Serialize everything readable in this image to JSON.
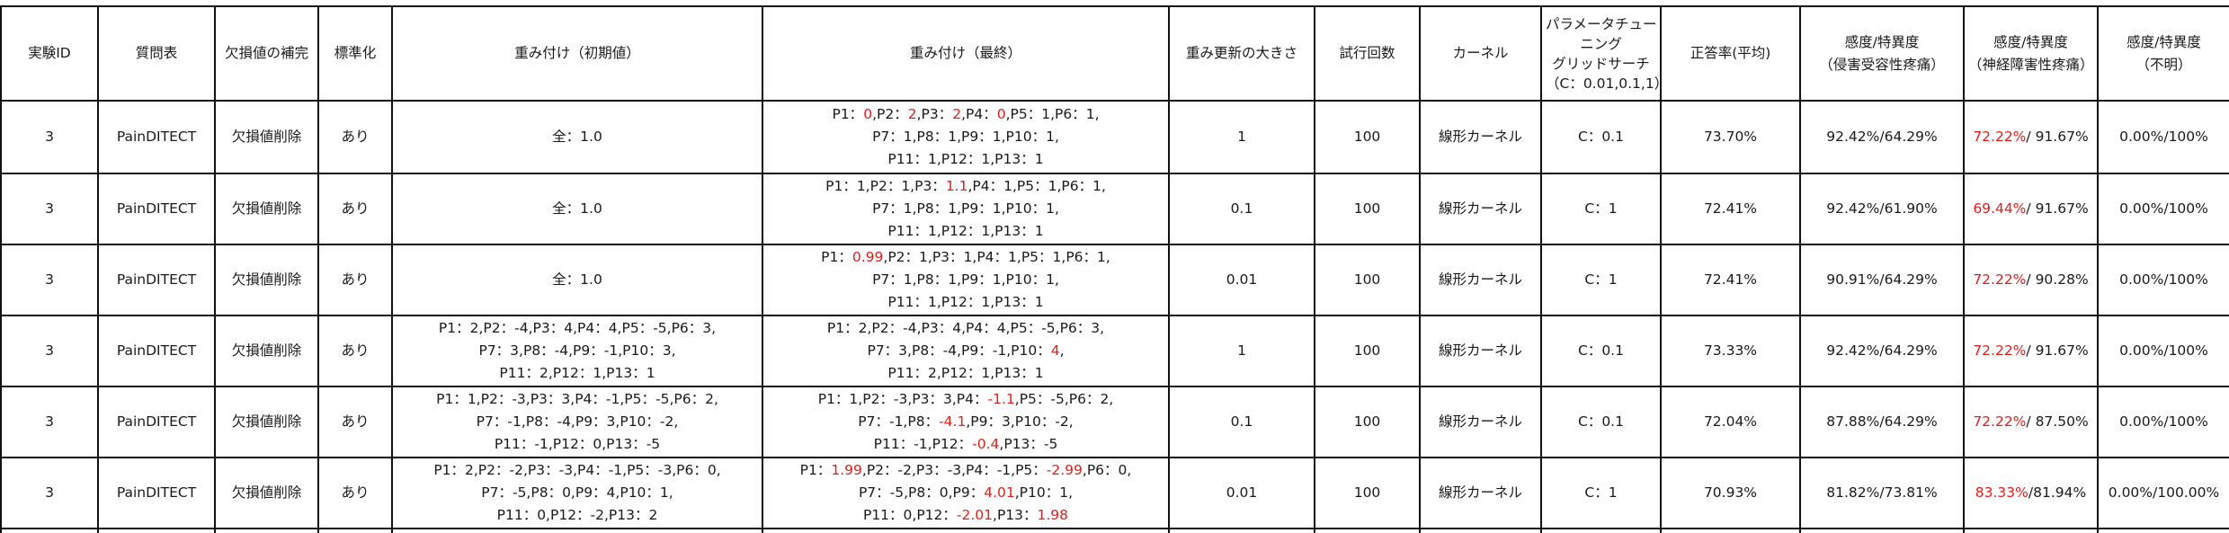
{
  "headers": [
    "実験ID",
    "質問表",
    "欠損値の補完",
    "標準化",
    "重み付け（初期値）",
    "重み付け（最終）",
    "重み更新の大きさ",
    "試行回数",
    "カーネル",
    "パラメータチューニンググリッドサーチ（C：0.01,0.1,1）",
    "正答率(平均)",
    "感度/特異度（侵害受容性疼痛）",
    "感度/特異度（神経障害性疼痛）",
    "感度/特異度（不明）"
  ],
  "header_lines": {
    "param": [
      "パラメータチュー",
      "ニング",
      "グリッドサーチ",
      "（C：0.01,0.1,1）"
    ],
    "nociceptive": [
      "感度/特異度",
      "（侵害受容性疼痛）"
    ],
    "neuropathic": [
      "感度/特異度",
      "（神経障害性疼痛）"
    ],
    "unknown": [
      "感度/特異度",
      "（不明）"
    ]
  },
  "colors": {
    "highlight": "#e0201c",
    "border": "#111111",
    "text": "#1a1a1a"
  },
  "rows": [
    {
      "id": "3",
      "questionnaire": "PainDITECT",
      "imputation": "欠損値削除",
      "standardization": "あり",
      "init": [
        [
          {
            "t": "全：1.0"
          }
        ]
      ],
      "final": [
        [
          {
            "t": "P1："
          },
          {
            "t": "0",
            "r": 1
          },
          {
            "t": ",P2："
          },
          {
            "t": "2",
            "r": 1
          },
          {
            "t": ",P3："
          },
          {
            "t": "2",
            "r": 1
          },
          {
            "t": ",P4："
          },
          {
            "t": "0",
            "r": 1
          },
          {
            "t": ",P5：1,P6：1,"
          }
        ],
        [
          {
            "t": "P7：1,P8：1,P9：1,P10：1,"
          }
        ],
        [
          {
            "t": "P11：1,P12：1,P13：1"
          }
        ]
      ],
      "update": "1",
      "trials": "100",
      "kernel": "線形カーネル",
      "param": "C：0.1",
      "accuracy": "73.70%",
      "nociceptive": [
        {
          "t": "92.42%/64.29%"
        }
      ],
      "neuropathic": [
        {
          "t": "72.22%",
          "r": 1
        },
        {
          "t": "/ 91.67%"
        }
      ],
      "unknown": "0.00%/100%"
    },
    {
      "id": "3",
      "questionnaire": "PainDITECT",
      "imputation": "欠損値削除",
      "standardization": "あり",
      "init": [
        [
          {
            "t": "全：1.0"
          }
        ]
      ],
      "final": [
        [
          {
            "t": "P1：1,P2：1,P3："
          },
          {
            "t": "1.1",
            "r": 1
          },
          {
            "t": ",P4：1,P5：1,P6：1,"
          }
        ],
        [
          {
            "t": "P7：1,P8：1,P9：1,P10：1,"
          }
        ],
        [
          {
            "t": "P11：1,P12：1,P13：1"
          }
        ]
      ],
      "update": "0.1",
      "trials": "100",
      "kernel": "線形カーネル",
      "param": "C：1",
      "accuracy": "72.41%",
      "nociceptive": [
        {
          "t": "92.42%/61.90%"
        }
      ],
      "neuropathic": [
        {
          "t": "69.44%",
          "r": 1
        },
        {
          "t": "/ 91.67%"
        }
      ],
      "unknown": "0.00%/100%"
    },
    {
      "id": "3",
      "questionnaire": "PainDITECT",
      "imputation": "欠損値削除",
      "standardization": "あり",
      "init": [
        [
          {
            "t": "全：1.0"
          }
        ]
      ],
      "final": [
        [
          {
            "t": "P1："
          },
          {
            "t": "0.99",
            "r": 1
          },
          {
            "t": ",P2：1,P3：1,P4：1,P5：1,P6：1,"
          }
        ],
        [
          {
            "t": "P7：1,P8：1,P9：1,P10：1,"
          }
        ],
        [
          {
            "t": "P11：1,P12：1,P13：1"
          }
        ]
      ],
      "update": "0.01",
      "trials": "100",
      "kernel": "線形カーネル",
      "param": "C：1",
      "accuracy": "72.41%",
      "nociceptive": [
        {
          "t": "90.91%/64.29%"
        }
      ],
      "neuropathic": [
        {
          "t": "72.22%",
          "r": 1
        },
        {
          "t": "/ 90.28%"
        }
      ],
      "unknown": "0.00%/100%"
    },
    {
      "id": "3",
      "questionnaire": "PainDITECT",
      "imputation": "欠損値削除",
      "standardization": "あり",
      "init": [
        [
          {
            "t": "P1：2,P2：-4,P3：4,P4：4,P5：-5,P6：3,"
          }
        ],
        [
          {
            "t": "P7：3,P8：-4,P9：-1,P10：3,"
          }
        ],
        [
          {
            "t": "P11：2,P12：1,P13：1"
          }
        ]
      ],
      "final": [
        [
          {
            "t": "P1：2,P2：-4,P3：4,P4：4,P5：-5,P6：3,"
          }
        ],
        [
          {
            "t": "P7：3,P8：-4,P9：-1,P10："
          },
          {
            "t": "4",
            "r": 1
          },
          {
            "t": ","
          }
        ],
        [
          {
            "t": "P11：2,P12：1,P13：1"
          }
        ]
      ],
      "update": "1",
      "trials": "100",
      "kernel": "線形カーネル",
      "param": "C：0.1",
      "accuracy": "73.33%",
      "nociceptive": [
        {
          "t": "92.42%/64.29%"
        }
      ],
      "neuropathic": [
        {
          "t": "72.22%",
          "r": 1
        },
        {
          "t": "/ 91.67%"
        }
      ],
      "unknown": "0.00%/100%"
    },
    {
      "id": "3",
      "questionnaire": "PainDITECT",
      "imputation": "欠損値削除",
      "standardization": "あり",
      "init": [
        [
          {
            "t": "P1：1,P2：-3,P3：3,P4：-1,P5：-5,P6：2,"
          }
        ],
        [
          {
            "t": "P7：-1,P8：-4,P9：3,P10：-2,"
          }
        ],
        [
          {
            "t": "P11：-1,P12：0,P13：-5"
          }
        ]
      ],
      "final": [
        [
          {
            "t": "P1：1,P2：-3,P3：3,P4："
          },
          {
            "t": "-1.1",
            "r": 1
          },
          {
            "t": ",P5：-5,P6：2,"
          }
        ],
        [
          {
            "t": "P7：-1,P8："
          },
          {
            "t": "-4.1",
            "r": 1
          },
          {
            "t": ",P9：3,P10：-2,"
          }
        ],
        [
          {
            "t": "P11：-1,P12："
          },
          {
            "t": "-0.4",
            "r": 1
          },
          {
            "t": ",P13：-5"
          }
        ]
      ],
      "update": "0.1",
      "trials": "100",
      "kernel": "線形カーネル",
      "param": "C：0.1",
      "accuracy": "72.04%",
      "nociceptive": [
        {
          "t": "87.88%/64.29%"
        }
      ],
      "neuropathic": [
        {
          "t": "72.22%",
          "r": 1
        },
        {
          "t": "/  87.50%"
        }
      ],
      "unknown": "0.00%/100%"
    },
    {
      "id": "3",
      "questionnaire": "PainDITECT",
      "imputation": "欠損値削除",
      "standardization": "あり",
      "init": [
        [
          {
            "t": "P1：2,P2：-2,P3：-3,P4：-1,P5：-3,P6：0,"
          }
        ],
        [
          {
            "t": "P7：-5,P8：0,P9：4,P10：1,"
          }
        ],
        [
          {
            "t": "P11：0,P12：-2,P13：2"
          }
        ]
      ],
      "final": [
        [
          {
            "t": "P1："
          },
          {
            "t": "1.99",
            "r": 1
          },
          {
            "t": ",P2：-2,P3：-3,P4：-1,P5："
          },
          {
            "t": "-2.99",
            "r": 1
          },
          {
            "t": ",P6：0,"
          }
        ],
        [
          {
            "t": "P7：-5,P8：0,P9："
          },
          {
            "t": "4.01",
            "r": 1
          },
          {
            "t": ",P10：1,"
          }
        ],
        [
          {
            "t": "P11：0,P12："
          },
          {
            "t": "-2.01",
            "r": 1
          },
          {
            "t": ",P13："
          },
          {
            "t": "1.98",
            "r": 1
          }
        ]
      ],
      "update": "0.01",
      "trials": "100",
      "kernel": "線形カーネル",
      "param": "C：1",
      "accuracy": "70.93%",
      "nociceptive": [
        {
          "t": "81.82%/73.81%"
        }
      ],
      "neuropathic": [
        {
          "t": "83.33%",
          "r": 1
        },
        {
          "t": "/81.94%"
        }
      ],
      "unknown": "0.00%/100.00%"
    }
  ]
}
